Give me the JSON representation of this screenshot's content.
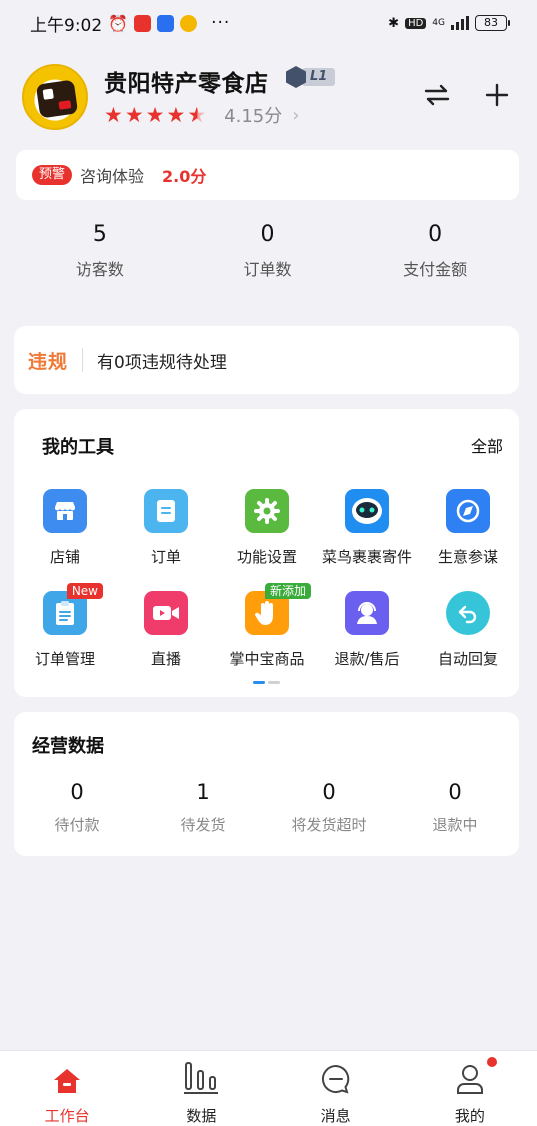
{
  "status_bar": {
    "time": "上午9:02",
    "network": "4G",
    "battery": "83"
  },
  "shop": {
    "name": "贵阳特产零食店",
    "level": "L1",
    "rating_stars": 4.15,
    "score": "4.15分",
    "chevron": "›"
  },
  "header_buttons": {
    "switch_icon": "swap-icon",
    "add_icon": "plus-icon"
  },
  "warning": {
    "tag": "预警",
    "text": "咨询体验",
    "score": "2.0分"
  },
  "stats": [
    {
      "value": "5",
      "label": "访客数"
    },
    {
      "value": "0",
      "label": "订单数"
    },
    {
      "value": "0",
      "label": "支付金额"
    }
  ],
  "violation": {
    "title": "违规",
    "text": "有0项违规待处理"
  },
  "tools": {
    "title": "我的工具",
    "all_label": "全部",
    "items": [
      {
        "label": "店铺",
        "icon": "store-icon",
        "color": "#3f8cf0"
      },
      {
        "label": "订单",
        "icon": "order-icon",
        "color": "#4cb4ee"
      },
      {
        "label": "功能设置",
        "icon": "gear-icon",
        "color": "#5ab93f"
      },
      {
        "label": "菜鸟裹裹寄件",
        "icon": "robot-icon",
        "color": "#1f8ef0"
      },
      {
        "label": "生意参谋",
        "icon": "compass-icon",
        "color": "#2f80f2"
      },
      {
        "label": "订单管理",
        "icon": "clipboard-icon",
        "color": "#3fa6e8",
        "badge": "New",
        "badge_color": "#e8322e"
      },
      {
        "label": "直播",
        "icon": "video-icon",
        "color": "#f03c6a"
      },
      {
        "label": "掌中宝商品",
        "icon": "hand-icon",
        "color": "#ff9d0a",
        "badge": "新添加",
        "badge_color": "#3bab3b"
      },
      {
        "label": "退款/售后",
        "icon": "service-icon",
        "color": "#6b5ff0"
      },
      {
        "label": "自动回复",
        "icon": "reply-icon",
        "color": "#36c5d8"
      }
    ],
    "page_indicator": {
      "pages": 2,
      "current": 1
    }
  },
  "business": {
    "title": "经营数据",
    "items": [
      {
        "value": "0",
        "label": "待付款"
      },
      {
        "value": "1",
        "label": "待发货"
      },
      {
        "value": "0",
        "label": "将发货超时"
      },
      {
        "value": "0",
        "label": "退款中"
      }
    ]
  },
  "tabbar": {
    "items": [
      {
        "label": "工作台",
        "icon": "home-icon",
        "active": true
      },
      {
        "label": "数据",
        "icon": "bar-chart-icon",
        "active": false
      },
      {
        "label": "消息",
        "icon": "chat-icon",
        "active": false
      },
      {
        "label": "我的",
        "icon": "user-icon",
        "active": false,
        "dot": true
      }
    ]
  },
  "colors": {
    "accent_red": "#e8322e",
    "violation_orange": "#ef7a35",
    "background": "#f2f2f6"
  }
}
